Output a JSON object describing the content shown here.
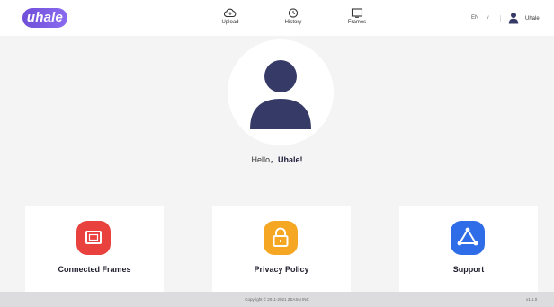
{
  "header": {
    "logo_text": "uhale",
    "nav": [
      {
        "label": "Upload",
        "icon": "cloud-upload-icon"
      },
      {
        "label": "History",
        "icon": "clock-icon"
      },
      {
        "label": "Frames",
        "icon": "frame-icon"
      }
    ],
    "language": "EN",
    "user_name": "Uhale"
  },
  "main": {
    "greeting_prefix": "Hello，",
    "greeting_name": "Uhale!",
    "cards": [
      {
        "label": "Connected Frames",
        "icon": "frame-icon",
        "color": "#e8413e"
      },
      {
        "label": "Privacy Policy",
        "icon": "lock-icon",
        "color": "#f5a623"
      },
      {
        "label": "Support",
        "icon": "support-icon",
        "color": "#2f6de8"
      }
    ]
  },
  "footer": {
    "copyright": "Copyright © 2011-2021 ZEASN INC",
    "version": "v1.1.0"
  },
  "colors": {
    "brand": "#7a5ae6",
    "avatar": "#363a66",
    "background": "#f4f4f5"
  }
}
